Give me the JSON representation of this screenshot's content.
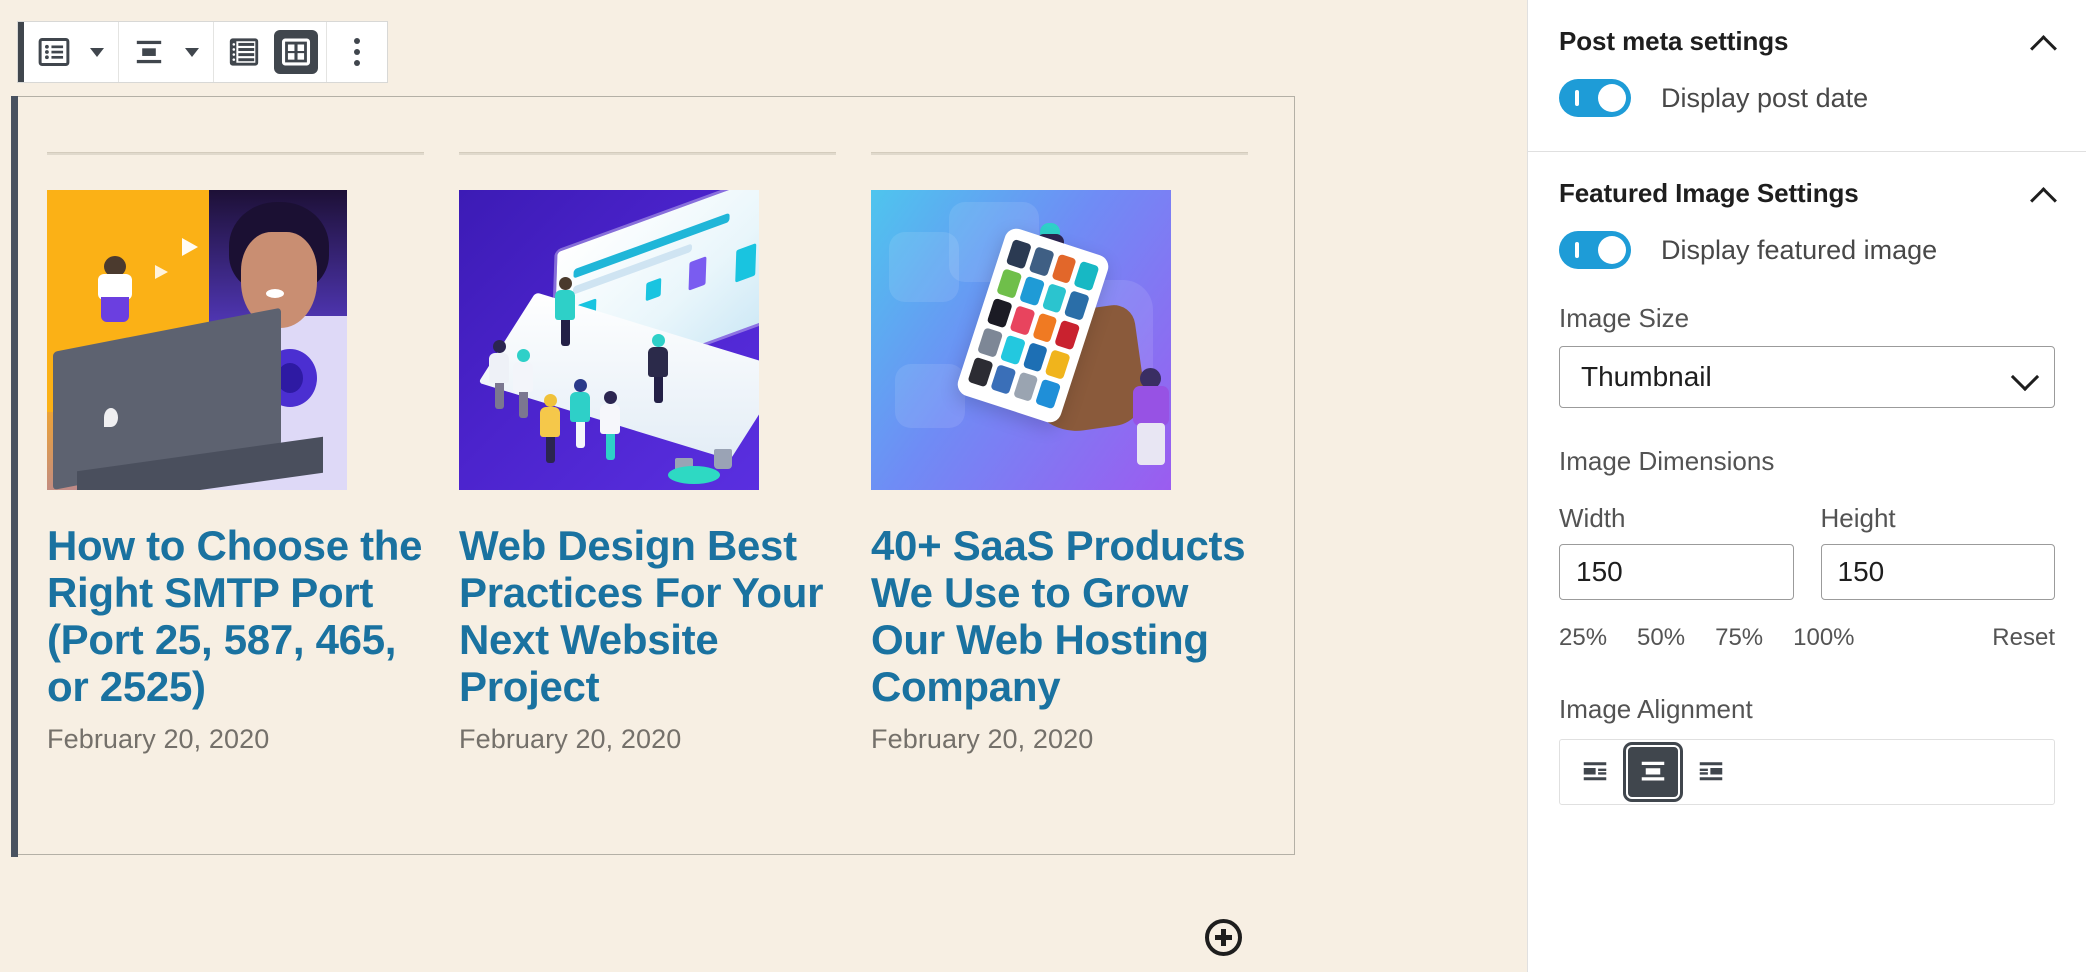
{
  "toolbar": {
    "block_type": {
      "name": "block-type-list-icon",
      "label": "Block type"
    },
    "block_type_caret": "caret-down",
    "align": {
      "name": "align-center-icon",
      "label": "Change alignment"
    },
    "align_caret": "caret-down",
    "list_view": {
      "name": "list-view-icon",
      "label": "List view"
    },
    "grid_view": {
      "name": "grid-view-icon",
      "label": "Grid view",
      "active": true
    },
    "more": {
      "name": "more-options-icon",
      "label": "More options"
    }
  },
  "canvas": {
    "add_block_label": "Add block",
    "posts": [
      {
        "title": "How to Choose the Right SMTP Port (Port 25, 587, 465, or 2525)",
        "date": "February 20, 2020",
        "image_name": "illustration-person-with-headphones-at-laptop"
      },
      {
        "title": "Web Design Best Practices For Your Next Website Project",
        "date": "February 20, 2020",
        "image_name": "illustration-isometric-team-building-website"
      },
      {
        "title": "40+ SaaS Products We Use to Grow Our Web Hosting Company",
        "date": "February 20, 2020",
        "image_name": "illustration-hand-holding-phone-with-app-grid"
      }
    ]
  },
  "sidebar": {
    "panels": [
      {
        "title": "Post meta settings",
        "collapse_icon": "chevron-up-icon",
        "toggles": [
          {
            "label": "Display post date",
            "on": true
          }
        ]
      },
      {
        "title": "Featured Image Settings",
        "collapse_icon": "chevron-up-icon",
        "toggles": [
          {
            "label": "Display featured image",
            "on": true
          }
        ],
        "image_size": {
          "label": "Image Size",
          "value": "Thumbnail",
          "chevron": "chevron-down-icon"
        },
        "image_dimensions": {
          "label": "Image Dimensions",
          "width_label": "Width",
          "width_value": "150",
          "height_label": "Height",
          "height_value": "150",
          "scale_buttons": [
            "25%",
            "50%",
            "75%",
            "100%"
          ],
          "reset_label": "Reset"
        },
        "image_alignment": {
          "label": "Image Alignment",
          "options": [
            {
              "name": "align-left-icon",
              "selected": false
            },
            {
              "name": "align-center-icon",
              "selected": true
            },
            {
              "name": "align-right-icon",
              "selected": false
            }
          ]
        }
      }
    ]
  },
  "colors": {
    "canvas_bg": "#f7efe3",
    "link_blue": "#1a72a0",
    "toggle_on": "#1e9cd7",
    "selection_dark": "#40464d"
  }
}
